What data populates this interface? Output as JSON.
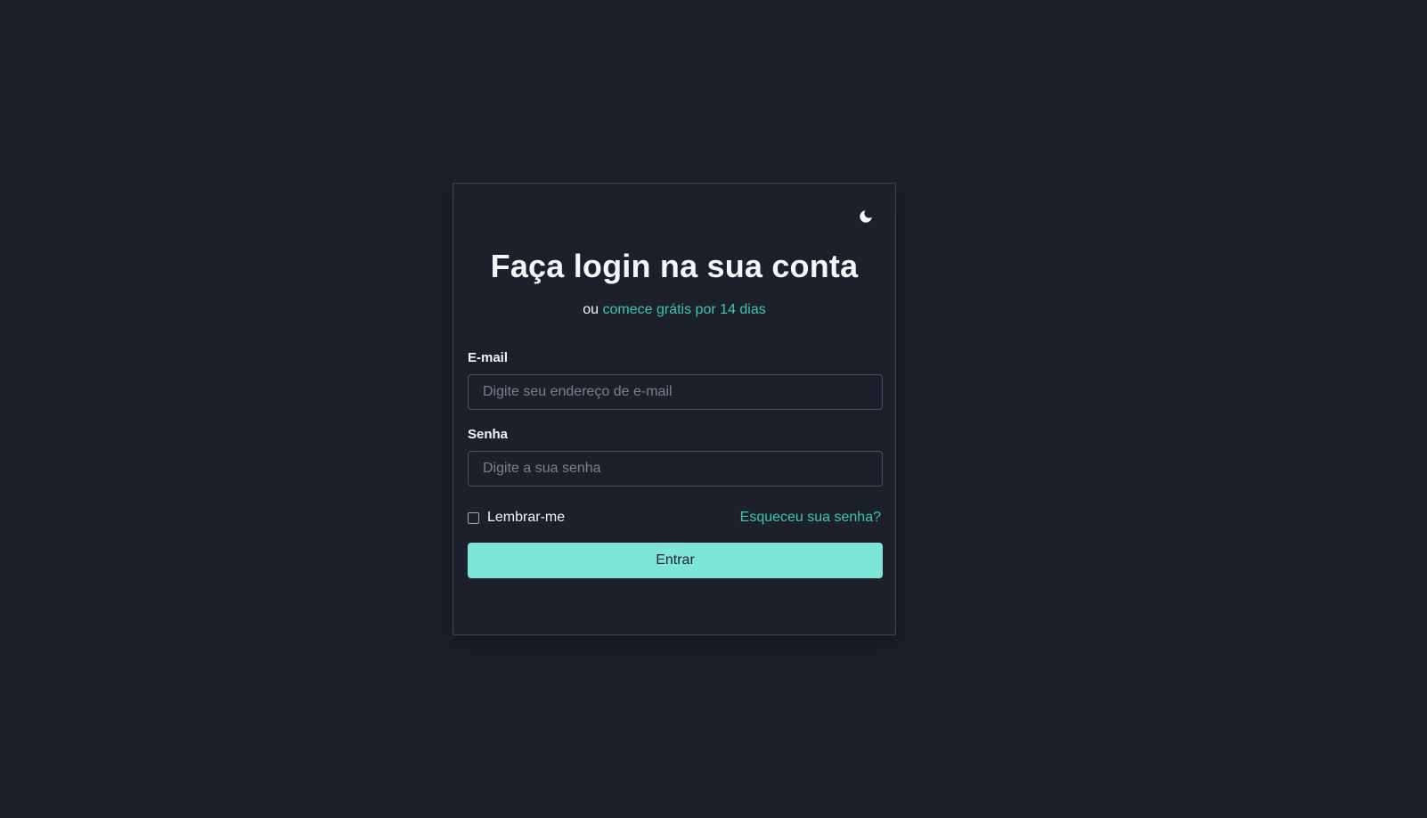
{
  "colors": {
    "background": "#1b202b",
    "accent": "#3ec6b4",
    "button": "#7ee6d9",
    "text": "#f4f6f8",
    "border": "#3f4653"
  },
  "theme_toggle": {
    "icon": "moon-icon"
  },
  "header": {
    "title": "Faça login na sua conta",
    "subtitle_prefix": "ou",
    "subtitle_link": "comece grátis por 14 dias"
  },
  "form": {
    "email": {
      "label": "E-mail",
      "value": "",
      "placeholder": "Digite seu endereço de e-mail"
    },
    "password": {
      "label": "Senha",
      "value": "",
      "placeholder": "Digite a sua senha"
    },
    "remember": {
      "label": "Lembrar-me",
      "checked": false
    },
    "forgot_link": "Esqueceu sua senha?",
    "submit_label": "Entrar"
  }
}
